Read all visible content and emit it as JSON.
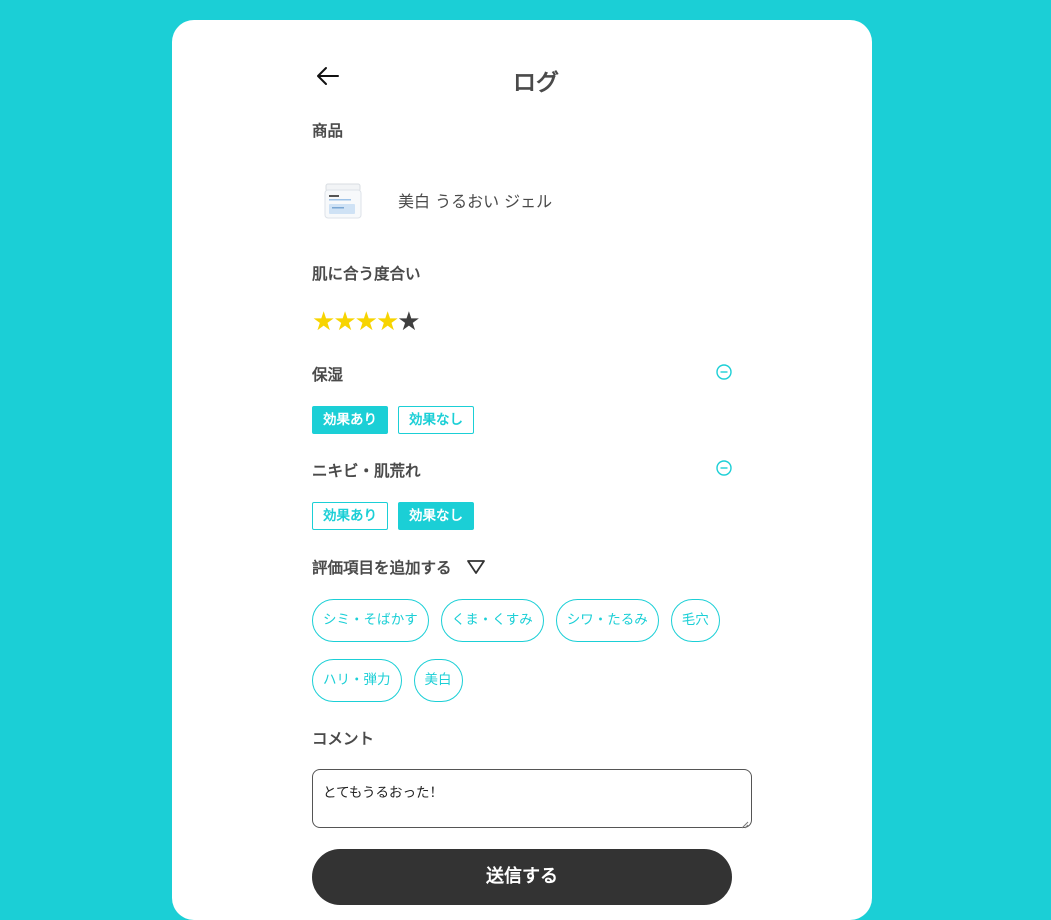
{
  "header": {
    "title": "ログ"
  },
  "product": {
    "section_label": "商品",
    "name": "美白 うるおい ジェル"
  },
  "rating": {
    "label": "肌に合う度合い",
    "value": 4,
    "max": 5,
    "filled_color": "#f7d400",
    "empty_color": "#3f3f3f"
  },
  "criteria": [
    {
      "label": "保湿",
      "options": [
        "効果あり",
        "効果なし"
      ],
      "selected": "効果あり"
    },
    {
      "label": "ニキビ・肌荒れ",
      "options": [
        "効果あり",
        "効果なし"
      ],
      "selected": "効果なし"
    }
  ],
  "add_section": {
    "label": "評価項目を追加する",
    "chips": [
      "シミ・そばかす",
      "くま・くすみ",
      "シワ・たるみ",
      "毛穴",
      "ハリ・弾力",
      "美白"
    ]
  },
  "comment": {
    "label": "コメント",
    "value": "とてもうるおった！"
  },
  "submit": {
    "label": "送信する"
  },
  "colors": {
    "accent": "#1bcfd6",
    "button_bg": "#333333",
    "background": "#1bcfd6"
  }
}
